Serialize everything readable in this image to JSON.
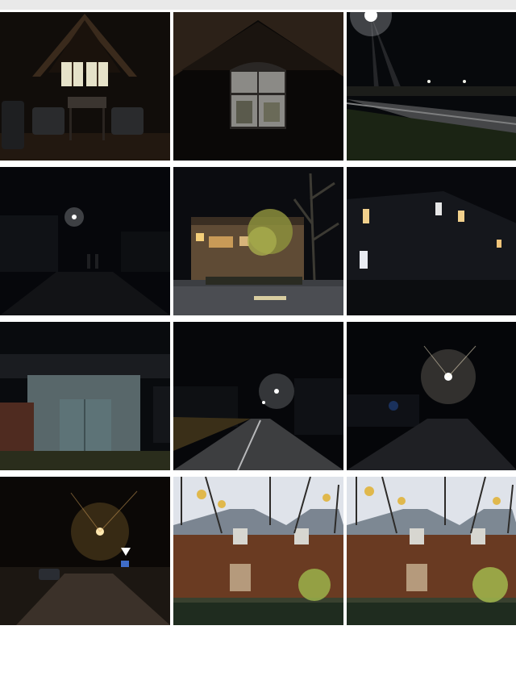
{
  "gallery": {
    "photos": [
      {
        "id": "attic-room",
        "icon": "photo-thumbnail"
      },
      {
        "id": "attic-window",
        "icon": "photo-thumbnail"
      },
      {
        "id": "night-road-streetlight",
        "icon": "photo-thumbnail"
      },
      {
        "id": "dark-street-figures",
        "icon": "photo-thumbnail"
      },
      {
        "id": "lit-house-tree",
        "icon": "photo-thumbnail"
      },
      {
        "id": "dark-building-windows",
        "icon": "photo-thumbnail"
      },
      {
        "id": "garage-door",
        "icon": "photo-thumbnail"
      },
      {
        "id": "road-center-light",
        "icon": "photo-thumbnail"
      },
      {
        "id": "road-bright-light",
        "icon": "photo-thumbnail"
      },
      {
        "id": "orange-street-car",
        "icon": "photo-thumbnail"
      },
      {
        "id": "wooden-house-day-1",
        "icon": "photo-thumbnail"
      },
      {
        "id": "wooden-house-day-2",
        "icon": "photo-thumbnail"
      }
    ]
  }
}
